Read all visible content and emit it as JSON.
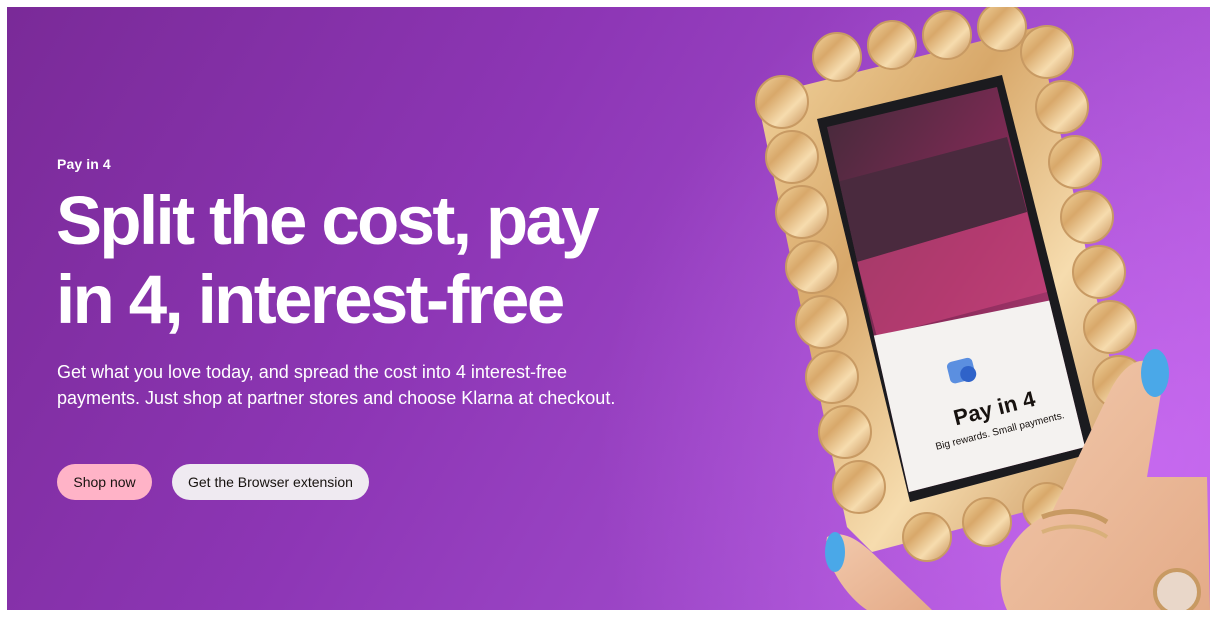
{
  "hero": {
    "eyebrow": "Pay in 4",
    "headline": "Split the cost, pay in 4, interest-free",
    "body": "Get what you love today, and spread the cost into 4 interest-free payments. Just shop at partner stores and choose Klarna at checkout.",
    "buttons": {
      "shop_now": "Shop now",
      "browser_extension": "Get the Browser extension"
    }
  },
  "phone_screen": {
    "title": "Pay in 4",
    "subtitle": "Big rewards. Small payments."
  },
  "colors": {
    "background_start": "#7a2a98",
    "background_end": "#b85be0",
    "primary_button": "#ffb3c7",
    "secondary_button": "#efeaf1",
    "text_on_hero": "#ffffff"
  }
}
